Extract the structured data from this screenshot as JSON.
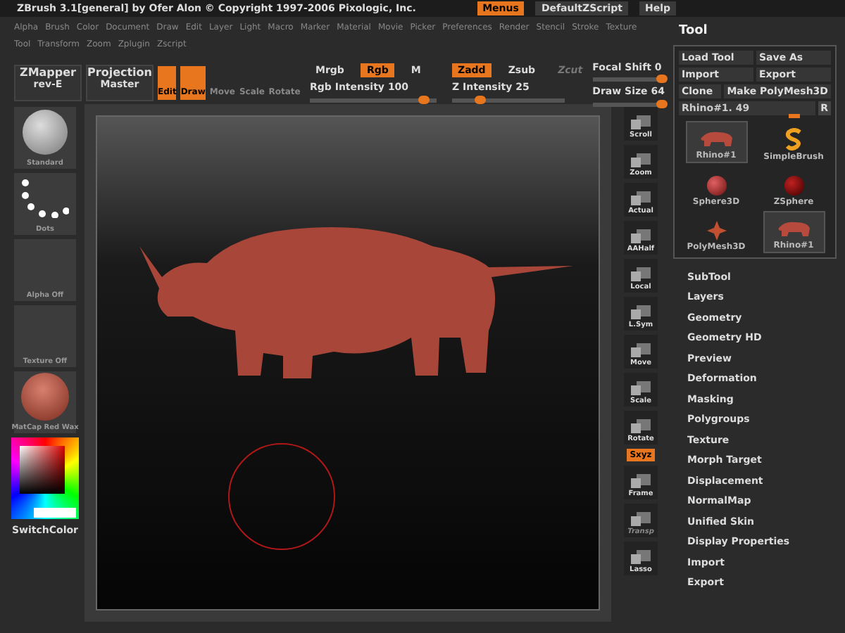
{
  "title_bar": {
    "title": "ZBrush  3.1[general] by Ofer Alon © Copyright 1997-2006 Pixologic, Inc.",
    "buttons": [
      {
        "label": "Menus",
        "selected": true
      },
      {
        "label": "DefaultZScript",
        "selected": false
      },
      {
        "label": "Help",
        "selected": false
      }
    ]
  },
  "menu_rows": [
    [
      "Alpha",
      "Brush",
      "Color",
      "Document",
      "Draw",
      "Edit",
      "Layer",
      "Light",
      "Macro",
      "Marker",
      "Material",
      "Movie",
      "Picker",
      "Preferences",
      "Render",
      "Stencil",
      "Stroke",
      "Texture"
    ],
    [
      "Tool",
      "Transform",
      "Zoom",
      "Zplugin",
      "Zscript"
    ]
  ],
  "toolbar": {
    "plugins": [
      {
        "line1": "ZMapper",
        "line2": "rev-E"
      },
      {
        "line1": "Projection",
        "line2": "Master"
      }
    ],
    "modes": [
      {
        "label": "Edit",
        "selected": true
      },
      {
        "label": "Draw",
        "selected": true
      },
      {
        "label": "Move",
        "selected": false
      },
      {
        "label": "Scale",
        "selected": false
      },
      {
        "label": "Rotate",
        "selected": false
      }
    ],
    "color_modes": [
      {
        "label": "Mrgb",
        "selected": false,
        "disabled": false
      },
      {
        "label": "Rgb",
        "selected": true,
        "disabled": false
      },
      {
        "label": "M",
        "selected": false,
        "disabled": false
      }
    ],
    "z_modes": [
      {
        "label": "Zadd",
        "selected": true,
        "disabled": false
      },
      {
        "label": "Zsub",
        "selected": false,
        "disabled": false
      },
      {
        "label": "Zcut",
        "selected": false,
        "disabled": true
      }
    ],
    "rgb_intensity": {
      "label": "Rgb Intensity",
      "value": "100",
      "level": 0.9
    },
    "z_intensity": {
      "label": "Z Intensity",
      "value": "25",
      "level": 0.25
    },
    "focal_shift": {
      "label": "Focal Shift",
      "value": "0",
      "level": 0.95
    },
    "draw_size": {
      "label": "Draw Size",
      "value": "64",
      "level": 0.95
    }
  },
  "left_shelf": {
    "slots": [
      {
        "kind": "brush",
        "label": "Standard"
      },
      {
        "kind": "stroke",
        "label": "Dots"
      },
      {
        "kind": "empty",
        "label": "Alpha Off"
      },
      {
        "kind": "empty",
        "label": "Texture Off"
      },
      {
        "kind": "material",
        "label": "MatCap Red Wax"
      }
    ],
    "color_label": "SwitchColor"
  },
  "right_shelf": [
    {
      "label": "Scroll",
      "kind": "button",
      "selected": false,
      "disabled": false
    },
    {
      "label": "Zoom",
      "kind": "button",
      "selected": false,
      "disabled": false
    },
    {
      "label": "Actual",
      "kind": "button",
      "selected": false,
      "disabled": false
    },
    {
      "label": "AAHalf",
      "kind": "button",
      "selected": false,
      "disabled": false
    },
    {
      "label": "Local",
      "kind": "button",
      "selected": false,
      "disabled": false
    },
    {
      "label": "L.Sym",
      "kind": "button",
      "selected": false,
      "disabled": false
    },
    {
      "label": "Move",
      "kind": "button",
      "selected": false,
      "disabled": false
    },
    {
      "label": "Scale",
      "kind": "button",
      "selected": false,
      "disabled": false
    },
    {
      "label": "Rotate",
      "kind": "button",
      "selected": false,
      "disabled": false
    },
    {
      "label": "Sxyz",
      "kind": "toggle",
      "selected": true
    },
    {
      "label": "Frame",
      "kind": "button",
      "selected": false,
      "disabled": false
    },
    {
      "label": "Transp",
      "kind": "button",
      "selected": false,
      "disabled": true
    },
    {
      "label": "Lasso",
      "kind": "button",
      "selected": false,
      "disabled": false
    }
  ],
  "tool_panel": {
    "title": "Tool",
    "buttons": [
      [
        "Load Tool",
        "Save As"
      ],
      [
        "Import",
        "Export"
      ],
      [
        "Clone",
        "Make PolyMesh3D"
      ]
    ],
    "current_tool": {
      "label": "Rhino#1. 49",
      "level": 0.85
    },
    "r_button": "R",
    "tools": [
      {
        "kind": "rhino",
        "label": "Rhino#1",
        "selected": true
      },
      {
        "kind": "simplebrush",
        "label": "SimpleBrush",
        "selected": false
      },
      {
        "kind": "sphere",
        "label": "Sphere3D",
        "selected": false
      },
      {
        "kind": "zsphere",
        "label": "ZSphere",
        "selected": false
      },
      {
        "kind": "polymesh",
        "label": "PolyMesh3D",
        "selected": false
      },
      {
        "kind": "rhino",
        "label": "Rhino#1",
        "selected": true
      }
    ],
    "sections": [
      "SubTool",
      "Layers",
      "Geometry",
      "Geometry HD",
      "Preview",
      "Deformation",
      "Masking",
      "Polygroups",
      "Texture",
      "Morph Target",
      "Displacement",
      "NormalMap",
      "Unified Skin",
      "Display Properties",
      "Import",
      "Export"
    ]
  }
}
